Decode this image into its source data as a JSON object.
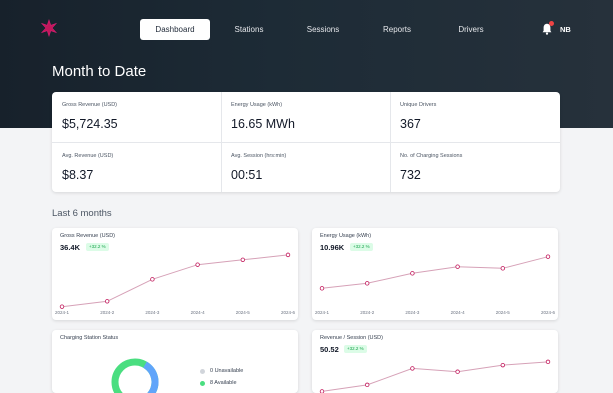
{
  "nav": {
    "items": [
      {
        "label": "Dashboard",
        "active": true
      },
      {
        "label": "Stations",
        "active": false
      },
      {
        "label": "Sessions",
        "active": false
      },
      {
        "label": "Reports",
        "active": false
      },
      {
        "label": "Drivers",
        "active": false
      }
    ],
    "user_initials": "NB",
    "notification_icon": "bell-icon",
    "logo_icon": "star-logo-icon"
  },
  "page": {
    "title": "Month to Date",
    "section_title": "Last 6 months"
  },
  "stats": [
    {
      "label": "Gross Revenue (USD)",
      "value": "$5,724.35"
    },
    {
      "label": "Energy Usage (kWh)",
      "value": "16.65 MWh"
    },
    {
      "label": "Unique Drivers",
      "value": "367"
    },
    {
      "label": "Avg. Revenue (USD)",
      "value": "$8.37"
    },
    {
      "label": "Avg. Session (hrs:min)",
      "value": "00:51"
    },
    {
      "label": "No. of Charging Sessions",
      "value": "732"
    }
  ],
  "cards": {
    "gross_revenue": {
      "title": "Gross Revenue (USD)",
      "value": "36.4K",
      "badge": "+32.2 %"
    },
    "energy_usage": {
      "title": "Energy Usage (kWh)",
      "value": "10.96K",
      "badge": "+32.2 %"
    },
    "station_status": {
      "title": "Charging Station Status",
      "legend": [
        {
          "label": "0 Unavailable",
          "color": "#d1d5db"
        },
        {
          "label": "8 Available",
          "color": "#4ade80"
        }
      ]
    },
    "revenue_session": {
      "title": "Revenue / Session (USD)",
      "value": "50.52",
      "badge": "+32.2 %"
    }
  },
  "colors": {
    "accent": "#c2185b",
    "line": "#d6a1b7",
    "positive": "#16a34a",
    "donut_teal": "#60a5fa",
    "donut_green": "#4ade80"
  },
  "chart_data": [
    {
      "type": "line",
      "name": "gross_revenue",
      "x": [
        "2024-1",
        "2024-2",
        "2024-3",
        "2024-4",
        "2024-5",
        "2024-6"
      ],
      "values": [
        0.2,
        3.5,
        17,
        26,
        29,
        32
      ],
      "ylim": [
        0,
        35
      ]
    },
    {
      "type": "line",
      "name": "energy_usage",
      "x": [
        "2024-1",
        "2024-2",
        "2024-3",
        "2024-4",
        "2024-5",
        "2024-6"
      ],
      "values": [
        8.7,
        9.0,
        9.6,
        10.0,
        9.9,
        10.6
      ],
      "ylim": [
        8,
        11
      ]
    },
    {
      "type": "line",
      "name": "revenue_per_session",
      "x": [
        "2024-1",
        "2024-2",
        "2024-3",
        "2024-4",
        "2024-5",
        "2024-6"
      ],
      "values": [
        40,
        42,
        47,
        46,
        48,
        49
      ],
      "ylim": [
        38,
        52
      ]
    },
    {
      "type": "pie",
      "name": "station_status",
      "categories": [
        "Unavailable",
        "Available"
      ],
      "values": [
        0,
        8
      ]
    }
  ]
}
